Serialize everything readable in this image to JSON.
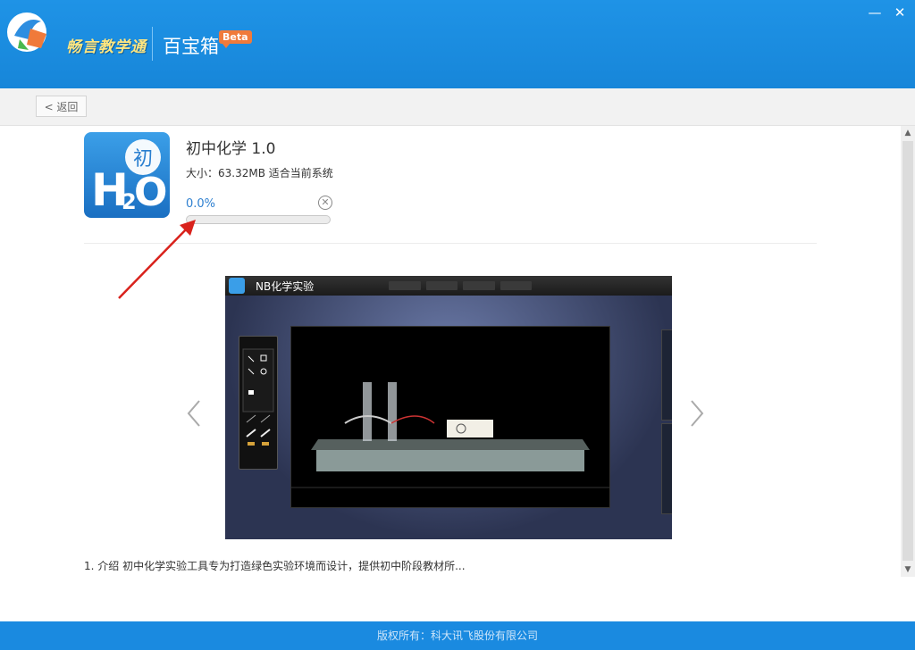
{
  "header": {
    "brand": "畅言教学通",
    "title": "百宝箱",
    "badge": "Beta",
    "minimize_icon": "minimize-icon",
    "close_icon": "close-icon"
  },
  "toolbar": {
    "back_label": "< 返回"
  },
  "app": {
    "name": "初中化学 1.0",
    "meta": "大小：63.32MB  适合当前系统",
    "progress_text": "0.0%",
    "progress": 0.0,
    "icon_letter_h": "H",
    "icon_letter_2": "2",
    "icon_letter_o": "O",
    "icon_badge": "初"
  },
  "screenshot": {
    "window_title": "NB化学实验"
  },
  "description": "1. 介绍 初中化学实验工具专为打造绿色实验环境而设计，提供初中阶段教材所...",
  "footer": {
    "copyright": "版权所有：科大讯飞股份有限公司"
  },
  "colors": {
    "header_blue": "#1f93e6",
    "accent": "#2f80d0",
    "annotation_red": "#d9221c"
  }
}
